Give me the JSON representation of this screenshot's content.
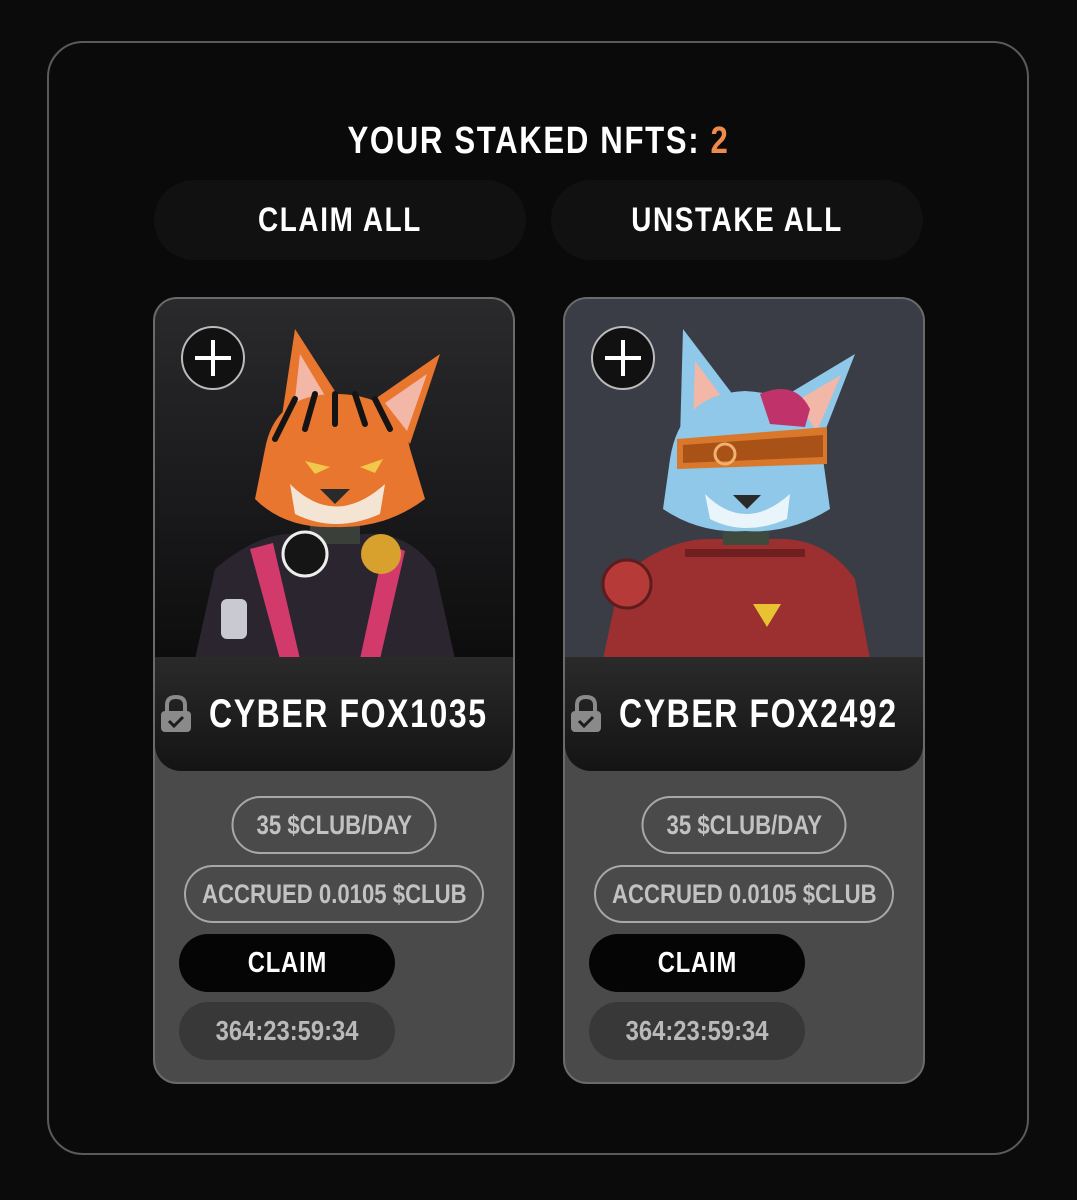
{
  "header": {
    "title_prefix": "YOUR STAKED NFTS:",
    "staked_count": "2"
  },
  "actions": {
    "claim_all_label": "CLAIM ALL",
    "unstake_all_label": "UNSTAKE ALL"
  },
  "cards": [
    {
      "name": "CYBER FOX1035",
      "rate": "35 $CLUB/DAY",
      "accrued": "ACCRUED 0.0105 $CLUB",
      "claim_label": "CLAIM",
      "timer": "364:23:59:34",
      "art_background": "#1a1a1c",
      "fur_color": "#e8762e"
    },
    {
      "name": "CYBER FOX2492",
      "rate": "35 $CLUB/DAY",
      "accrued": "ACCRUED 0.0105 $CLUB",
      "claim_label": "CLAIM",
      "timer": "364:23:59:34",
      "art_background": "#3a3c46",
      "fur_color": "#8fc8e8"
    }
  ],
  "icons": {
    "add": "plus-icon",
    "lock": "lock-icon"
  },
  "colors": {
    "accent": "#f08a4b",
    "card_body": "#4a4a4b",
    "page_bg": "#0b0b0c"
  }
}
